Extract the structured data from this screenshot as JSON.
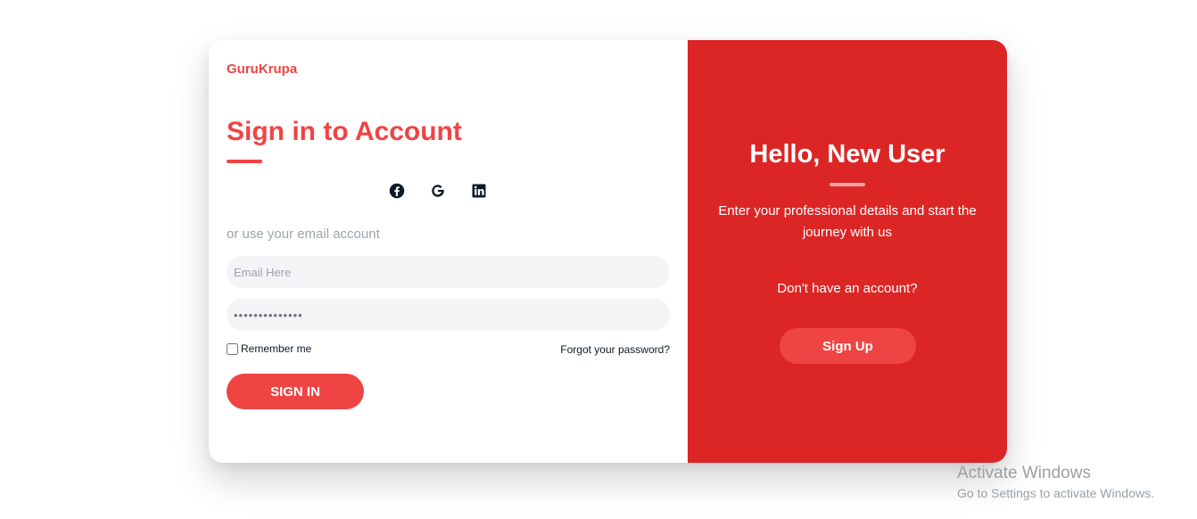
{
  "brand": "GuruKrupa",
  "signin": {
    "title": "Sign in to Account",
    "socials": [
      "facebook-icon",
      "google-icon",
      "linkedin-icon"
    ],
    "or_text": "or use your email account",
    "email_placeholder": "Email Here",
    "password_value": "••••••••••••••",
    "remember_label": "Remember me",
    "forgot_label": "Forgot your password?",
    "button_label": "SIGN IN"
  },
  "signup_panel": {
    "title": "Hello, New User",
    "description": "Enter your professional details and start the journey with us",
    "prompt": "Don't have an account?",
    "button_label": "Sign Up"
  },
  "watermark": {
    "title": "Activate Windows",
    "subtitle": "Go to Settings to activate Windows."
  },
  "colors": {
    "accent": "#ef4444",
    "panel": "#dc2626"
  }
}
